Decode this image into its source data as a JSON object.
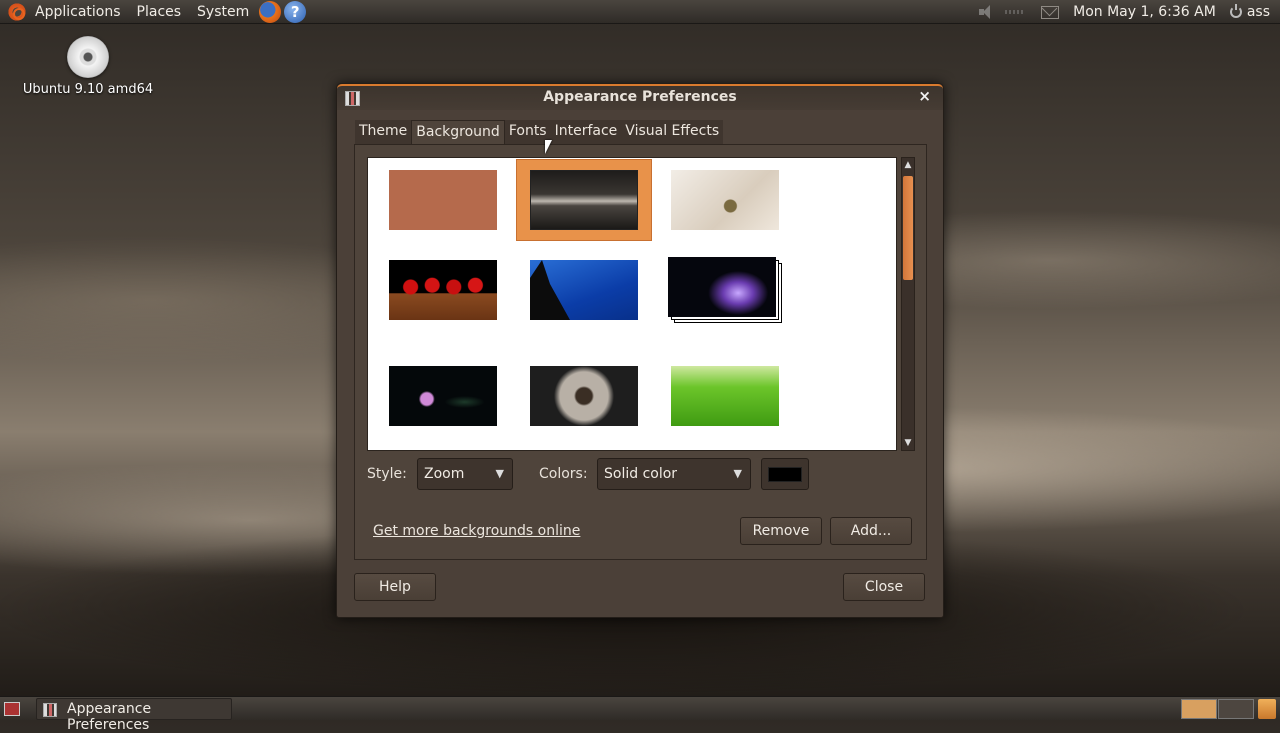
{
  "top_panel": {
    "menus": [
      "Applications",
      "Places",
      "System"
    ],
    "clock": "Mon May  1,  6:36 AM",
    "user": "ass"
  },
  "desktop": {
    "icon_label": "Ubuntu 9.10 amd64"
  },
  "window": {
    "title": "Appearance Preferences",
    "close_glyph": "×",
    "tabs": [
      "Theme",
      "Background",
      "Fonts",
      "Interface",
      "Visual Effects"
    ],
    "active_tab": "Background",
    "wallpapers": [
      "solid-color",
      "dark-clouds",
      "butterfly",
      "cherries",
      "blue-sky",
      "nebula",
      "lotus",
      "hands",
      "grass"
    ],
    "selected_wallpaper": "dark-clouds",
    "style_label": "Style:",
    "style_value": "Zoom",
    "colors_label": "Colors:",
    "colors_value": "Solid color",
    "color_swatch": "#000000",
    "online_link": "Get more backgrounds online",
    "remove_button": "Remove",
    "add_button": "Add...",
    "help_button": "Help",
    "close_button": "Close"
  },
  "bottom_panel": {
    "task_label": "Appearance Preferences"
  },
  "colors": {
    "accent": "#e8924a",
    "window_bg": "#4b4038"
  }
}
